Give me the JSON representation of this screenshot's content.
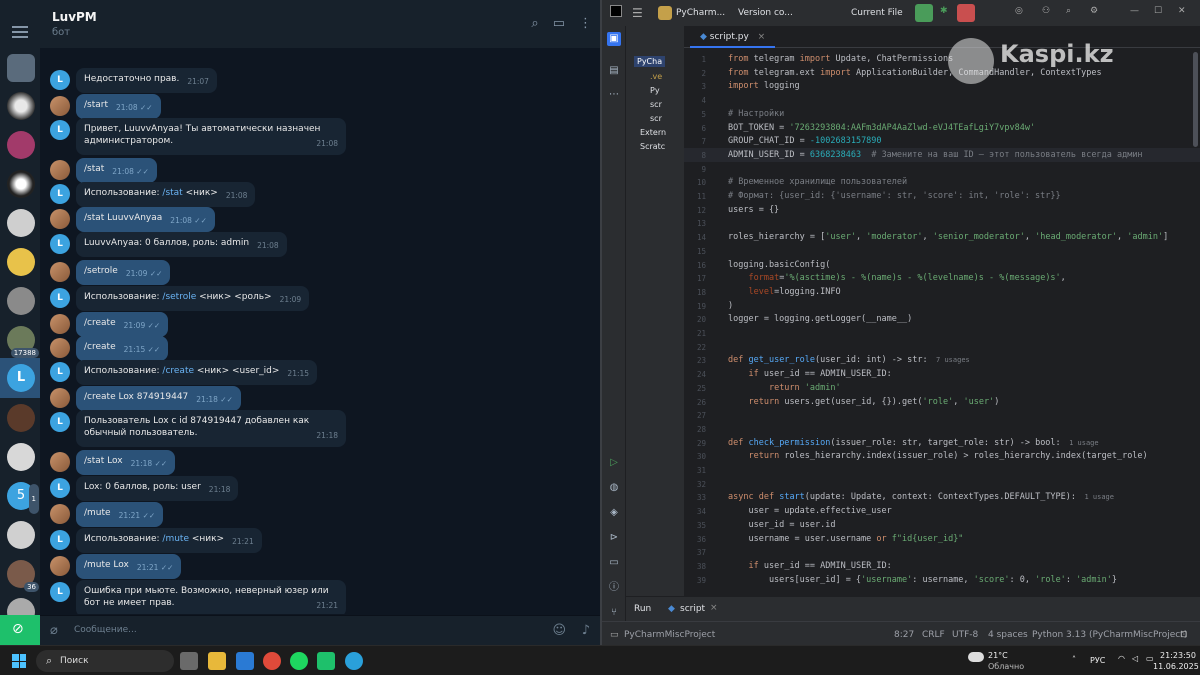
{
  "telegram": {
    "chat_title": "LuvPM",
    "chat_subtitle": "бот",
    "input_placeholder": "Сообщение...",
    "chat_badges": {
      "b1": "17388",
      "b2": "1",
      "b3": "36",
      "letter": "5"
    },
    "bot_letter": "L",
    "messages": [
      {
        "who": "bot",
        "text": "Недостаточно прав.",
        "time": "21:07"
      },
      {
        "who": "me",
        "text": "/start",
        "time": "21:08"
      },
      {
        "who": "bot",
        "text": "Привет, LuuvvAnyaa! Ты автоматически назначен администратором.",
        "time": "21:08"
      },
      {
        "who": "me",
        "text": "/stat",
        "time": "21:08"
      },
      {
        "who": "bot",
        "pre": "Использование: ",
        "cmd": "/stat",
        "post": " <ник>",
        "time": "21:08"
      },
      {
        "who": "me",
        "text": "/stat LuuvvAnyaa",
        "time": "21:08"
      },
      {
        "who": "bot",
        "text": "LuuvvAnyaa: 0 баллов, роль: admin",
        "time": "21:08"
      },
      {
        "who": "me",
        "text": "/setrole",
        "time": "21:09"
      },
      {
        "who": "bot",
        "pre": "Использование: ",
        "cmd": "/setrole",
        "post": " <ник> <роль>",
        "time": "21:09"
      },
      {
        "who": "me",
        "text": "/create",
        "time": "21:09"
      },
      {
        "who": "me",
        "text": "/create",
        "time": "21:15"
      },
      {
        "who": "bot",
        "pre": "Использование: ",
        "cmd": "/create",
        "post": " <ник> <user_id>",
        "time": "21:15"
      },
      {
        "who": "me",
        "text": "/create Lox 874919447",
        "time": "21:18"
      },
      {
        "who": "bot",
        "text": "Пользователь Lox с id 874919447 добавлен как обычный пользователь.",
        "time": "21:18"
      },
      {
        "who": "me",
        "text": "/stat Lox",
        "time": "21:18"
      },
      {
        "who": "bot",
        "text": "Lox: 0 баллов, роль: user",
        "time": "21:18"
      },
      {
        "who": "me",
        "text": "/mute",
        "time": "21:21"
      },
      {
        "who": "bot",
        "pre": "Использование: ",
        "cmd": "/mute",
        "post": " <ник>",
        "time": "21:21"
      },
      {
        "who": "me",
        "text": "/mute Lox",
        "time": "21:21"
      },
      {
        "who": "bot",
        "text": "Ошибка при мьюте. Возможно, неверный юзер или бот не имеет прав.",
        "time": "21:21"
      }
    ]
  },
  "pycharm": {
    "project_name": "PyCha",
    "project_menu": "PyCharm...",
    "vcs_menu": "Version co...",
    "run_config": "Current File",
    "tab_label": "script.py",
    "tree": [
      ".ve",
      "Py",
      "scr",
      "scr",
      "Extern",
      "Scratc"
    ],
    "run_tab": "Run",
    "run_file": "script",
    "code_lines": [
      "from telegram import Update, ChatPermissions",
      "from telegram.ext import ApplicationBuilder, CommandHandler, ContextTypes",
      "import logging",
      "",
      "# Настройки",
      "BOT_TOKEN = '7263293804:AAFm3dAP4AaZlwd-eVJ4TEafLgiY7vpv84w'",
      "GROUP_CHAT_ID = -1002683157890",
      "ADMIN_USER_ID = 6368238463  # Замените на ваш ID — этот пользователь всегда админ",
      "",
      "# Временное хранилище пользователей",
      "# Формат: {user_id: {'username': str, 'score': int, 'role': str}}",
      "users = {}",
      "",
      "roles_hierarchy = ['user', 'moderator', 'senior_moderator', 'head_moderator', 'admin']",
      "",
      "logging.basicConfig(",
      "    format='%(asctime)s - %(name)s - %(levelname)s - %(message)s',",
      "    level=logging.INFO",
      ")",
      "logger = logging.getLogger(__name__)",
      "",
      "",
      "def get_user_role(user_id: int) -> str:",
      "    if user_id == ADMIN_USER_ID:",
      "        return 'admin'",
      "    return users.get(user_id, {}).get('role', 'user')",
      "",
      "",
      "def check_permission(issuer_role: str, target_role: str) -> bool:",
      "    return roles_hierarchy.index(issuer_role) > roles_hierarchy.index(target_role)",
      "",
      "",
      "async def start(update: Update, context: ContextTypes.DEFAULT_TYPE):",
      "    user = update.effective_user",
      "    user_id = user.id",
      "    username = user.username or f\"id{user_id}\"",
      "",
      "    if user_id == ADMIN_USER_ID:",
      "        users[user_id] = {'username': username, 'score': 0, 'role': 'admin'}"
    ],
    "hints": {
      "get_user_role": "7 usages",
      "check_permission": "1 usage",
      "start": "1 usage"
    },
    "status": {
      "position": "8:27",
      "line_sep": "CRLF",
      "encoding": "UTF-8",
      "indent": "4 spaces",
      "interpreter": "Python 3.13 (PyCharmMiscProject)",
      "breadcrumb": "PyCharmMiscProject"
    }
  },
  "watermark": "Kaspi.kz",
  "taskbar": {
    "search": "Поиск",
    "weather_temp": "21°C",
    "weather_desc": "Облачно",
    "lang": "РУС",
    "time": "21:23:50",
    "date": "11.06.2025"
  }
}
